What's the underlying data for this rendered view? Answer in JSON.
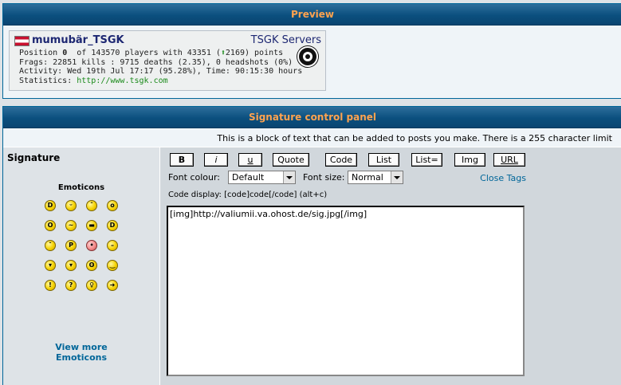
{
  "preview": {
    "header": "Preview",
    "player_name": "mumubär_TSGK",
    "server": "TSGK Servers",
    "line1_pre": "Position ",
    "position": "0",
    "line1_mid": "  of 143570 players with 43351 (",
    "points_delta": "2169",
    "line1_post": ") points",
    "line2": "Frags: 22851 kills : 9715 deaths (2.35), 0 headshots (0%)",
    "line3": "Activity: Wed 19th Jul 17:17 (95.28%), Time: 90:15:30 hours",
    "line4_pre": "Statistics: ",
    "stats_url": "http://www.tsgk.com"
  },
  "panel": {
    "header": "Signature control panel",
    "description": "This is a block of text that can be added to posts you make. There is a 255 character limit",
    "signature_label": "Signature",
    "emoticons_title": "Emoticons",
    "emoticons": [
      "big-grin",
      "smile",
      "sad",
      "surprised",
      "shocked",
      "confused",
      "cool",
      "laughing",
      "mad",
      "razz",
      "embarrassed",
      "neutral",
      "evil",
      "twisted-evil",
      "rolling-eyes",
      "wink",
      "exclaim",
      "question",
      "idea",
      "arrow"
    ],
    "view_more_1": "View more",
    "view_more_2": "Emoticons",
    "buttons": {
      "b": "B",
      "i": "i",
      "u": "u",
      "quote": "Quote",
      "code": "Code",
      "list": "List",
      "list_eq": "List=",
      "img": "Img",
      "url": "URL"
    },
    "font_colour_label": "Font colour:",
    "font_colour_value": "Default",
    "font_size_label": "Font size:",
    "font_size_value": "Normal",
    "close_tags": "Close Tags",
    "code_display": "Code display: [code]code[/code]  (alt+c)",
    "signature_text": "[img]http://valiumii.va.ohost.de/sig.jpg[/img]"
  }
}
